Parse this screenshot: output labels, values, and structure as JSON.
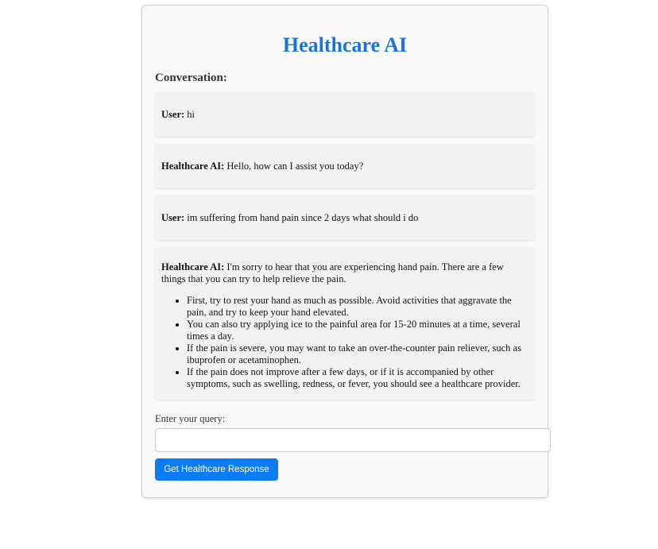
{
  "app": {
    "title": "Healthcare AI"
  },
  "conversation": {
    "heading": "Conversation:",
    "messages": [
      {
        "speaker": "User:",
        "text": " hi"
      },
      {
        "speaker": "Healthcare AI:",
        "text": " Hello, how can I assist you today?"
      },
      {
        "speaker": "User:",
        "text": " im suffering from hand pain since 2 days what should i do"
      },
      {
        "speaker": "Healthcare AI:",
        "text": " I'm sorry to hear that you are experiencing hand pain. There are a few things that you can try to help relieve the pain.",
        "bullets": [
          "First, try to rest your hand as much as possible. Avoid activities that aggravate the pain, and try to keep your hand elevated.",
          "You can also try applying ice to the painful area for 15-20 minutes at a time, several times a day.",
          "If the pain is severe, you may want to take an over-the-counter pain reliever, such as ibuprofen or acetaminophen.",
          "If the pain does not improve after a few days, or if it is accompanied by other symptoms, such as swelling, redness, or fever, you should see a healthcare provider."
        ]
      }
    ]
  },
  "query": {
    "label": "Enter your query:",
    "value": "",
    "placeholder": ""
  },
  "submit": {
    "label": "Get Healthcare Response"
  },
  "colors": {
    "title": "#1a73d9",
    "button": "#0a7cf5"
  }
}
